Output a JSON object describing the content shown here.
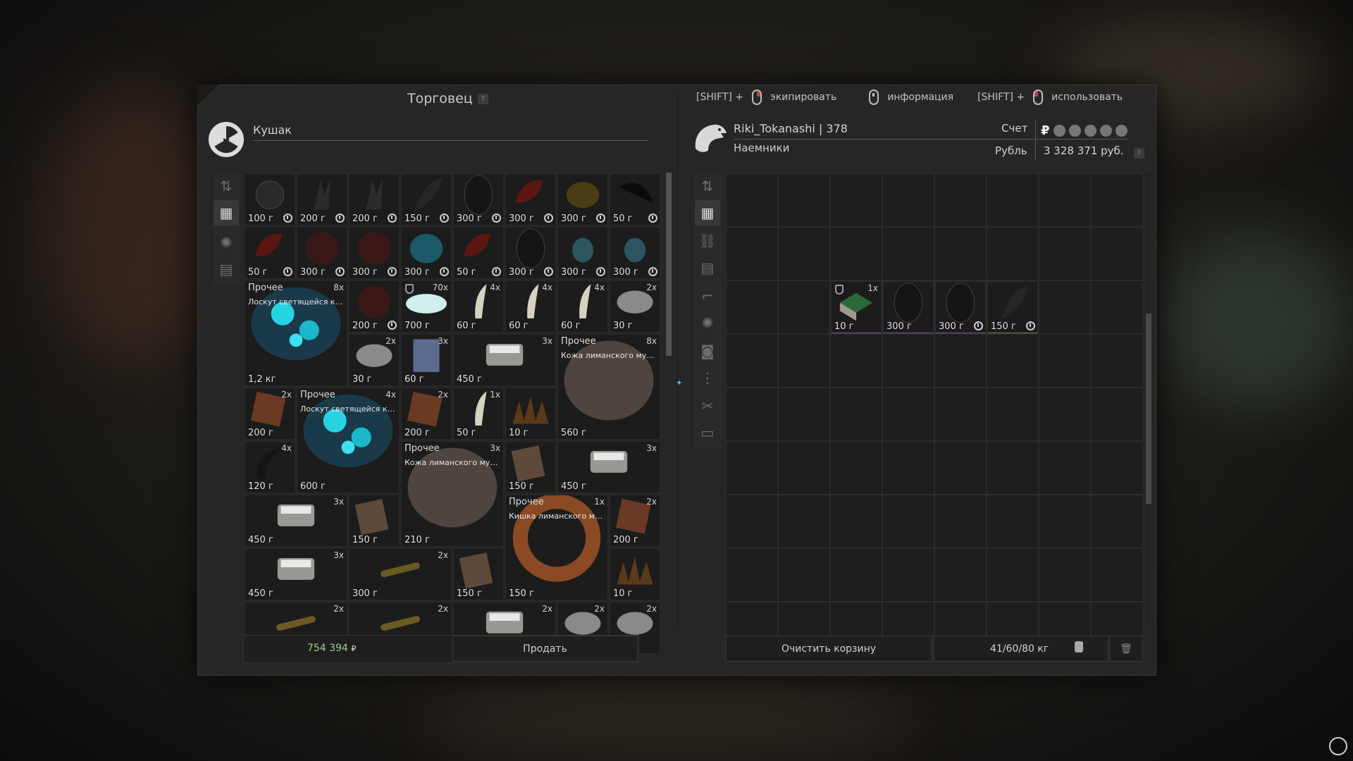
{
  "trader": {
    "title": "Торговец",
    "help": "?",
    "name": "Кушак",
    "total": "754 394",
    "currency_sign": "₽",
    "sell_label": "Продать"
  },
  "hints": [
    {
      "prefix": "[SHIFT] +",
      "label": "экипировать"
    },
    {
      "prefix": "",
      "label": "информация"
    },
    {
      "prefix": "[SHIFT] +",
      "label": "использовать"
    }
  ],
  "player": {
    "name": "Riki_Tokanashi | 378",
    "faction": "Наемники",
    "account_label": "Счет",
    "currency_label": "Рубль",
    "balance": "3 328 371 руб.",
    "help": "?",
    "clear_label": "Очистить корзину",
    "weight": "41/60/80 кг"
  },
  "colors": {
    "accent": "#9fd08a",
    "slot_bg": "#1c1c1c",
    "panel_bg": "#262626"
  },
  "trader_items": [
    {
      "p": "100 г",
      "t": 1,
      "ic": "bag"
    },
    {
      "p": "200 г",
      "t": 1,
      "ic": "claw"
    },
    {
      "p": "200 г",
      "t": 1,
      "ic": "claw"
    },
    {
      "p": "150 г",
      "t": 1,
      "ic": "feather"
    },
    {
      "p": "300 г",
      "t": 1,
      "ic": "dark"
    },
    {
      "p": "300 г",
      "t": 1,
      "ic": "red"
    },
    {
      "p": "300 г",
      "t": 1,
      "ic": "olive"
    },
    {
      "p": "50 г",
      "t": 1,
      "ic": "black"
    },
    {
      "p": "50 г",
      "t": 1,
      "ic": "red"
    },
    {
      "p": "300 г",
      "t": 1,
      "ic": "maroon"
    },
    {
      "p": "300 г",
      "t": 1,
      "ic": "maroon"
    },
    {
      "p": "300 г",
      "t": 1,
      "ic": "teal"
    },
    {
      "p": "50 г",
      "t": 1,
      "ic": "red"
    },
    {
      "p": "300 г",
      "t": 1,
      "ic": "dark"
    },
    {
      "p": "300 г",
      "t": 1,
      "ic": "blue"
    },
    {
      "p": "300 г",
      "t": 1,
      "ic": "blue"
    },
    {
      "p": "1,2 кг",
      "c": "8x",
      "cat": "Прочее",
      "nm": "Лоскут светящейся кож...",
      "ic": "glow"
    },
    {
      "p": "200 г",
      "t": 1,
      "ic": "maroon"
    },
    {
      "p": "700 г",
      "c": "70x",
      "sh": 1,
      "ic": "crystal"
    },
    {
      "p": "60 г",
      "c": "4x",
      "ic": "tooth"
    },
    {
      "p": "60 г",
      "c": "4x",
      "ic": "tooth"
    },
    {
      "p": "60 г",
      "c": "4x",
      "ic": "tooth"
    },
    {
      "p": "30 г",
      "c": "2x",
      "ic": "stone"
    },
    {
      "p": "30 г",
      "c": "2x",
      "ic": "stone"
    },
    {
      "p": "60 г",
      "c": "3x",
      "ic": "book"
    },
    {
      "p": "450 г",
      "c": "3x",
      "ic": "tray"
    },
    {
      "p": "560 г",
      "c": "8x",
      "cat": "Прочее",
      "nm": "Кожа лиманского мутан...",
      "ic": "hide"
    },
    {
      "p": "200 г",
      "c": "2x",
      "ic": "leather"
    },
    {
      "p": "600 г",
      "c": "4x",
      "cat": "Прочее",
      "nm": "Лоскут светящейся кож...",
      "ic": "glow"
    },
    {
      "p": "200 г",
      "c": "2x",
      "ic": "leather"
    },
    {
      "p": "50 г",
      "c": "1x",
      "ic": "tooth"
    },
    {
      "p": "10 г",
      "ic": "spike"
    },
    {
      "p": "120 г",
      "c": "4x",
      "ic": "horn"
    },
    {
      "p": "210 г",
      "c": "3x",
      "cat": "Прочее",
      "nm": "Кожа лиманского мутан...",
      "ic": "hide"
    },
    {
      "p": "150 г",
      "ic": "map"
    },
    {
      "p": "450 г",
      "c": "3x",
      "ic": "tray"
    },
    {
      "p": "450 г",
      "c": "3x",
      "ic": "tray"
    },
    {
      "p": "150 г",
      "ic": "map"
    },
    {
      "p": "150 г",
      "c": "1x",
      "cat": "Прочее",
      "nm": "Кишка лиманского мут...",
      "ic": "gut"
    },
    {
      "p": "200 г",
      "c": "2x",
      "ic": "leather"
    },
    {
      "p": "450 г",
      "c": "3x",
      "ic": "tray"
    },
    {
      "p": "300 г",
      "c": "2x",
      "ic": "bone"
    },
    {
      "p": "150 г",
      "ic": "map"
    },
    {
      "p": "10 г",
      "ic": "spike"
    },
    {
      "p": "",
      "c": "2x",
      "ic": "bone"
    },
    {
      "p": "",
      "c": "2x",
      "ic": "bone"
    },
    {
      "p": "",
      "c": "2x",
      "ic": "tray"
    },
    {
      "p": "",
      "c": "2x",
      "ic": "stone"
    },
    {
      "p": "",
      "c": "2x",
      "ic": "stone"
    }
  ],
  "cart_items": [
    {
      "p": "10 г",
      "c": "1x",
      "sh": 1,
      "ic": "box",
      "b": "bp"
    },
    {
      "p": "300 г",
      "ic": "dark",
      "b": "bp"
    },
    {
      "p": "300 г",
      "t": 1,
      "ic": "dark",
      "b": "bp"
    },
    {
      "p": "150 г",
      "t": 1,
      "ic": "feather",
      "b": "bt"
    }
  ]
}
